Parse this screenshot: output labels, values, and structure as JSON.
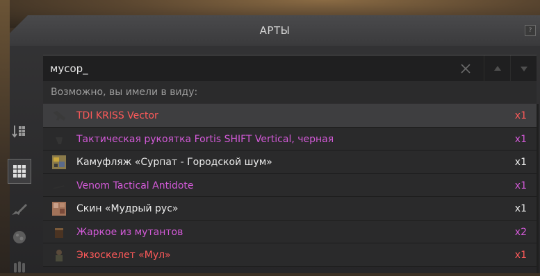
{
  "window": {
    "title": "АРТЫ",
    "help_label": "?"
  },
  "search": {
    "value": "мусор_"
  },
  "hint": "Возможно, вы имели в виду:",
  "sidebar": [
    {
      "icon": "sort-icon"
    },
    {
      "icon": "grid-icon",
      "active": true
    },
    {
      "icon": "rifle-icon"
    },
    {
      "icon": "artifact-icon"
    },
    {
      "icon": "ammo-icon"
    }
  ],
  "results": [
    {
      "name": "TDI KRISS Vector",
      "qty": "x1",
      "color": "#ff5a5a",
      "icon": "smg-icon"
    },
    {
      "name": "Тактическая рукоятка Fortis SHIFT Vertical, черная",
      "qty": "x1",
      "color": "#d35ad8",
      "icon": "grip-icon"
    },
    {
      "name": "Камуфляж «Сурпат - Городской шум»",
      "qty": "x1",
      "color": "#ececec",
      "icon": "camo-icon"
    },
    {
      "name": "Venom Tactical Antidote",
      "qty": "x1",
      "color": "#d35ad8",
      "icon": "syringe-icon"
    },
    {
      "name": "Скин «Мудрый рус»",
      "qty": "x1",
      "color": "#ececec",
      "icon": "skin-icon"
    },
    {
      "name": "Жаркое из мутантов",
      "qty": "x2",
      "color": "#d35ad8",
      "icon": "food-can-icon"
    },
    {
      "name": "Экзоскелет «Мул»",
      "qty": "x1",
      "color": "#ff5a5a",
      "icon": "exoskeleton-icon"
    }
  ]
}
